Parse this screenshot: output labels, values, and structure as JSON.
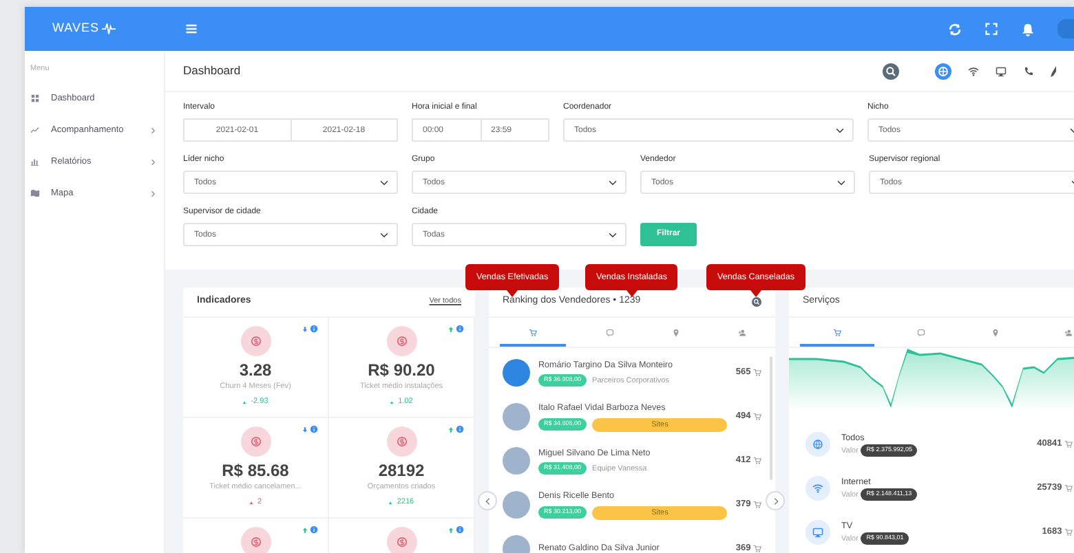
{
  "brand": {
    "name": "WAVES"
  },
  "page_title": "Dashboard",
  "sidebar": {
    "heading": "Menu",
    "items": [
      {
        "label": "Dashboard",
        "has_submenu": false
      },
      {
        "label": "Acompanhamento",
        "has_submenu": true
      },
      {
        "label": "Relatórios",
        "has_submenu": true
      },
      {
        "label": "Mapa",
        "has_submenu": true
      }
    ]
  },
  "filters": [
    [
      {
        "kind": "date_range",
        "label": "Intervalo",
        "values": [
          "2021-02-01",
          "2021-02-18"
        ]
      },
      {
        "kind": "time_range",
        "label": "Hora inicial e final",
        "values": [
          "00:00",
          "23:59"
        ]
      },
      {
        "kind": "select",
        "label": "Coordenador",
        "value": "Todos"
      },
      {
        "kind": "select",
        "label": "Nicho",
        "value": "Todos"
      }
    ],
    [
      {
        "kind": "select",
        "label": "Líder nicho",
        "value": "Todos"
      },
      {
        "kind": "select",
        "label": "Grupo",
        "value": "Todos"
      },
      {
        "kind": "select",
        "label": "Vendedor",
        "value": "Todos"
      },
      {
        "kind": "select",
        "label": "Supervisor regional",
        "value": "Todos"
      }
    ],
    [
      {
        "kind": "select",
        "label": "Supervisor de cidade",
        "value": "Todos"
      },
      {
        "kind": "select",
        "label": "Cidade",
        "value": "Todas"
      },
      {
        "kind": "button",
        "label": "Filtrar"
      }
    ]
  ],
  "indicators": {
    "title": "Indicadores",
    "link": "Ver todos",
    "items": [
      {
        "value": "3.28",
        "label": "Churn 4 Meses (Fev)",
        "delta": "-2.93",
        "trending_up": false,
        "negative": false
      },
      {
        "value": "R$ 90.20",
        "label": "Ticket médio instalações",
        "delta": "1.02",
        "trending_up": true,
        "negative": false
      },
      {
        "value": "R$ 85.68",
        "label": "Ticket médio cancelamen...",
        "delta": "2",
        "trending_up": false,
        "negative": true
      },
      {
        "value": "28192",
        "label": "Orçamentos criados",
        "delta": "2216",
        "trending_up": true,
        "negative": false
      },
      {
        "trending_up": true
      },
      {
        "trending_up": true
      }
    ]
  },
  "ranking": {
    "title": "Ranking dos Vendedores • 1239",
    "tabs": [
      {
        "selected": true
      },
      {
        "selected": false
      },
      {
        "selected": false
      },
      {
        "selected": false
      }
    ],
    "rows": [
      {
        "name": "Romário Targino Da Silva Monteiro",
        "amount": "R$ 36.908,00",
        "kind": "team",
        "team": "Parceiros Corporativos",
        "count": "565"
      },
      {
        "name": "Italo Rafael Vidal Barboza Neves",
        "amount": "R$ 34.606,00",
        "kind": "tag",
        "tag": "Sites",
        "count": "494"
      },
      {
        "name": "Miguel Silvano De Lima Neto",
        "amount": "R$ 31.408,00",
        "kind": "team",
        "team": "Equipe Vanessa",
        "count": "412"
      },
      {
        "name": "Denis Ricelle Bento",
        "amount": "R$ 30.213,00",
        "kind": "tag",
        "tag": "Sites",
        "count": "379"
      },
      {
        "name": "Renato Galdino Da Silva Junior",
        "kind": "partial",
        "count": "369"
      }
    ]
  },
  "services": {
    "title": "Serviços",
    "tabs": [
      {
        "selected": true
      },
      {
        "selected": false
      },
      {
        "selected": false
      },
      {
        "selected": false
      }
    ],
    "items": [
      {
        "name": "Todos",
        "caption": "Valor",
        "amount": "R$ 2.375.992,05",
        "count": "40841"
      },
      {
        "name": "Internet",
        "caption": "Valor",
        "amount": "R$ 2.148.411,13",
        "count": "25739"
      },
      {
        "name": "TV",
        "caption": "Valor",
        "amount": "R$ 90.843,01",
        "count": "1683"
      }
    ]
  },
  "tooltips": [
    {
      "label": "Vendas Efetivadas"
    },
    {
      "label": "Vendas Instaladas"
    },
    {
      "label": "Vendas Canseladas"
    }
  ]
}
